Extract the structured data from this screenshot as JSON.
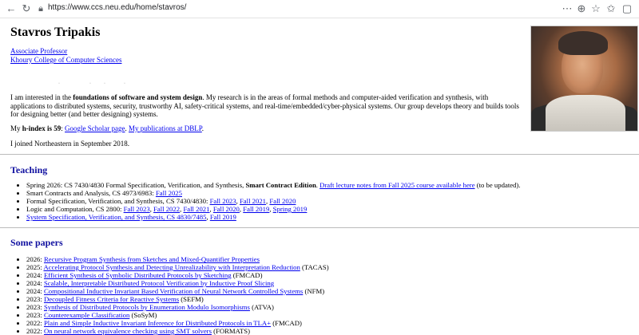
{
  "browser": {
    "url_host": "https://www.ccs.neu.edu",
    "url_path": "/home/stavros/"
  },
  "profile": {
    "name": "Stavros Tripakis",
    "title": "Associate Professor",
    "college": "Khoury College of Computer Sciences",
    "intro_part1": "I am interested in the ",
    "intro_bold": "foundations of software and system design",
    "intro_part2": ". My research is in the areas of formal methods and computer-aided verification and synthesis, with applications to distributed systems, security, trustworthy AI, safety-critical systems, and real-time/embedded/cyber-physical systems. Our group develops theory and builds tools for designing better (and better designing) systems.",
    "hindex_prefix": "My ",
    "hindex_bold": "h-index is 59",
    "hindex_sep1": ": ",
    "scholar_link": "Google Scholar page",
    "hindex_sep2": ". ",
    "dblp_link": "My publications at DBLP",
    "hindex_end": ".",
    "joined": "I joined Northeastern in September 2018."
  },
  "teaching": {
    "heading": "Teaching",
    "item1_text": "Spring 2026: CS 7430/4830 Formal Specification, Verification, and Synthesis, ",
    "item1_bold": "Smart Contract Edition",
    "item1_sep": ". ",
    "item1_link": "Draft lecture notes from Fall 2025 course available here",
    "item1_end": " (to be updated).",
    "item2_text": "Smart Contracts and Analysis, CS 4973/6983: ",
    "item2_link1": "Fall 2025",
    "item3_text": "Formal Specification, Verification, and Synthesis, CS 7430/4830: ",
    "item3_link1": "Fall 2023",
    "item3_link2": "Fall 2021",
    "item3_link3": "Fall 2020",
    "item4_text": "Logic and Computation, CS 2800: ",
    "item4_link1": "Fall 2023",
    "item4_link2": "Fall 2022",
    "item4_link3": "Fall 2021",
    "item4_link4": "Fall 2020",
    "item4_link5": "Fall 2019",
    "item4_link6": "Spring 2019",
    "item5_link1": "System Specification, Verification, and Synthesis, CS 4830/7485",
    "item5_link2": "Fall 2019",
    "comma": ", "
  },
  "papers": {
    "heading": "Some papers",
    "items": [
      {
        "year": "2026: ",
        "title": "Recursive Program Synthesis from Sketches and Mixed-Quantifier Properties",
        "venue": ""
      },
      {
        "year": "2025: ",
        "title": "Accelerating Protocol Synthesis and Detecting Unrealizability with Interpretation Reduction",
        "venue": " (TACAS)"
      },
      {
        "year": "2024: ",
        "title": "Efficient Synthesis of Symbolic Distributed Protocols by Sketching",
        "venue": " (FMCAD)"
      },
      {
        "year": "2024: ",
        "title": "Scalable, Interpretable Distributed Protocol Verification by Inductive Proof Slicing",
        "venue": ""
      },
      {
        "year": "2024: ",
        "title": "Compositional Inductive Invariant Based Verification of Neural Network Controlled Systems",
        "venue": " (NFM)"
      },
      {
        "year": "2023: ",
        "title": "Decoupled Fitness Criteria for Reactive Systems",
        "venue": " (SEFM)"
      },
      {
        "year": "2023: ",
        "title": "Synthesis of Distributed Protocols by Enumeration Modulo Isomorphisms",
        "venue": " (ATVA)"
      },
      {
        "year": "2023: ",
        "title": "Counterexample Classification",
        "venue": " (SoSyM)"
      },
      {
        "year": "2022: ",
        "title": "Plain and Simple Inductive Invariant Inference for Distributed Protocols in TLA+",
        "venue": " (FMCAD)"
      },
      {
        "year": "2022: ",
        "title": "On neural network equivalence checking using SMT solvers",
        "venue": " (FORMATS)"
      }
    ]
  },
  "colors": {
    "link": "#0000ee",
    "heading": "#1010a0"
  }
}
